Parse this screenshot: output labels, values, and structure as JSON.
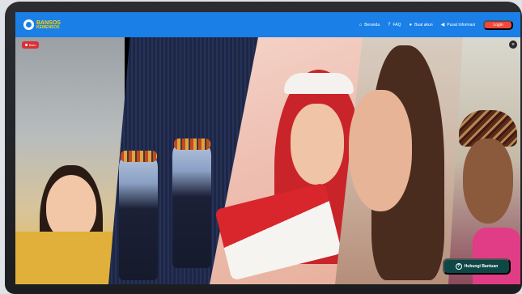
{
  "header": {
    "logo": {
      "line1": "BANSOS",
      "line2": "KEMENSOS"
    },
    "nav": [
      {
        "icon": "home-icon",
        "glyph": "⌂",
        "label": "Beranda"
      },
      {
        "icon": "question-icon",
        "glyph": "?",
        "label": "FAQ"
      },
      {
        "icon": "user-icon",
        "glyph": "●",
        "label": "Buat akun"
      },
      {
        "icon": "megaphone-icon",
        "glyph": "◀",
        "label": "Pusat Informasi"
      }
    ],
    "login_label": "Login"
  },
  "hero": {
    "badge_label": "Baru",
    "close_glyph": "×"
  },
  "help_button": {
    "glyph": "?",
    "label": "Hubungi Bantuan"
  },
  "colors": {
    "navbar": "#1a7fe6",
    "login": "#f0483e",
    "help": "#0f4746",
    "badge": "#d83035"
  }
}
